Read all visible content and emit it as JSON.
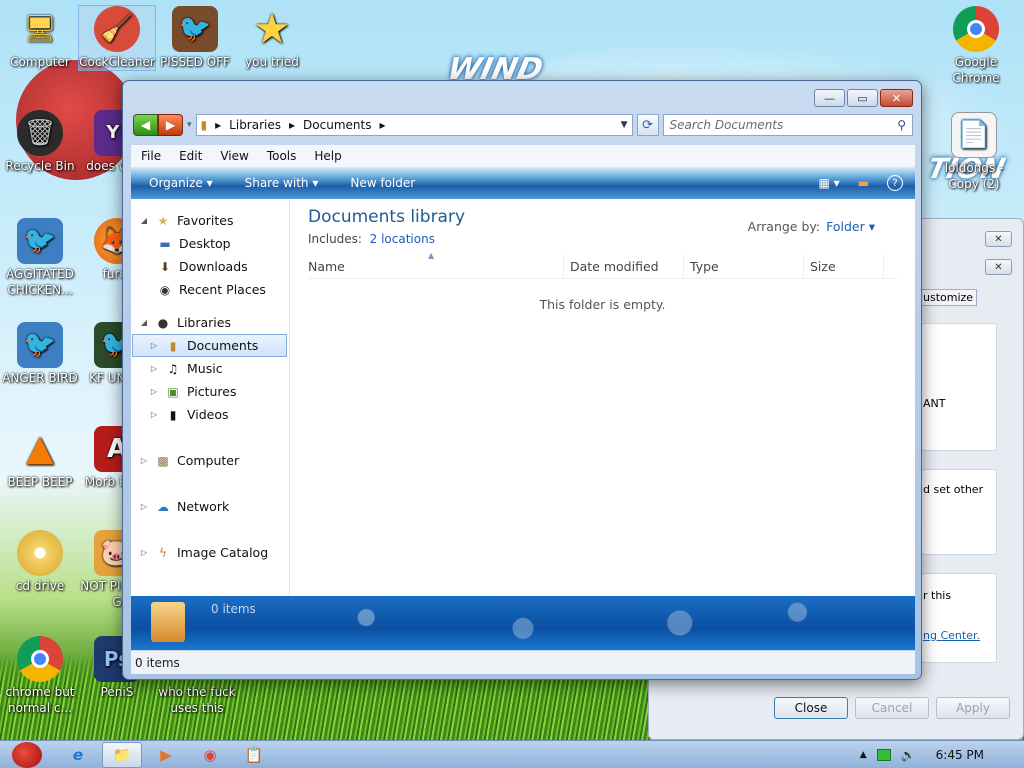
{
  "desktop": {
    "icons": [
      {
        "label": "Computer",
        "glyph": "🖥",
        "bg": "#6b7f95"
      },
      {
        "label": "CockCleaner",
        "glyph": "🧹",
        "bg": "#d74b3a"
      },
      {
        "label": "PISSED OFF",
        "glyph": "🐦",
        "bg": "#7a4b2a"
      },
      {
        "label": "you tried",
        "glyph": "★",
        "bg": "transparent"
      },
      {
        "label": "Google Chrome",
        "glyph": "◉",
        "bg": "transparent"
      },
      {
        "label": "Recycle Bin",
        "glyph": "🗑",
        "bg": "#3a3a3a"
      },
      {
        "label": "does work",
        "glyph": "Y!",
        "bg": "#5b2a8a"
      },
      {
        "label": "loldongs - Copy (2)",
        "glyph": "📄",
        "bg": "transparent"
      },
      {
        "label": "AGGITATED CHICKEN...",
        "glyph": "🐦",
        "bg": "#3e7ec2"
      },
      {
        "label": "furry",
        "glyph": "🦊",
        "bg": "transparent"
      },
      {
        "label": "ANGER BIRD",
        "glyph": "🐦",
        "bg": "#3e7ec2"
      },
      {
        "label": "KF UNIVE",
        "glyph": "🐦",
        "bg": "#2a4a2a"
      },
      {
        "label": "BEEP BEEP",
        "glyph": "▲",
        "bg": "transparent"
      },
      {
        "label": "Morb Read",
        "glyph": "A",
        "bg": "#b71c1c"
      },
      {
        "label": "cd drive",
        "glyph": "◎",
        "bg": "transparent"
      },
      {
        "label": "NOT PI BIRD G",
        "glyph": "🐷",
        "bg": "#e6a33b"
      },
      {
        "label": "chrome but normal c...",
        "glyph": "◉",
        "bg": "transparent"
      },
      {
        "label": "PeniS",
        "glyph": "Ps",
        "bg": "#1e3a6e"
      },
      {
        "label": "who the fuck uses this",
        "glyph": "",
        "bg": "transparent"
      }
    ],
    "wallpaper_text": [
      "WIND",
      "TION"
    ]
  },
  "window": {
    "controls": {
      "minimize": "—",
      "maximize": "▭",
      "close": "✕"
    },
    "nav": {
      "back": "◀",
      "forward": "▶"
    },
    "address": {
      "segments": [
        "Libraries",
        "Documents"
      ],
      "sep": "▸"
    },
    "search_placeholder": "Search Documents",
    "menu": [
      "File",
      "Edit",
      "View",
      "Tools",
      "Help"
    ],
    "commands": {
      "organize": "Organize ▾",
      "share": "Share with ▾",
      "new_folder": "New folder",
      "help": "?"
    },
    "navpane": {
      "favorites": {
        "label": "Favorites",
        "items": [
          "Desktop",
          "Downloads",
          "Recent Places"
        ]
      },
      "libraries": {
        "label": "Libraries",
        "items": [
          "Documents",
          "Music",
          "Pictures",
          "Videos"
        ],
        "selected": "Documents"
      },
      "computer": "Computer",
      "network": "Network",
      "image_catalog": "Image Catalog"
    },
    "main": {
      "title": "Documents library",
      "includes_label": "Includes:",
      "includes_link": "2 locations",
      "arrange_label": "Arrange by:",
      "arrange_value": "Folder ▾",
      "columns": [
        "Name",
        "Date modified",
        "Type",
        "Size"
      ],
      "empty_text": "This folder is empty."
    },
    "details_count": "0 items",
    "status_count": "0 items"
  },
  "dialog": {
    "tab_label": "ustomize",
    "fragments": [
      "ANT",
      "d set other",
      "r this",
      "ng Center."
    ],
    "buttons": {
      "close": "Close",
      "cancel": "Cancel",
      "apply": "Apply"
    }
  },
  "taskbar": {
    "clock": "6:45 PM",
    "buttons": [
      "🐦",
      "e",
      "📁",
      "▶",
      "◉",
      "📋"
    ]
  }
}
